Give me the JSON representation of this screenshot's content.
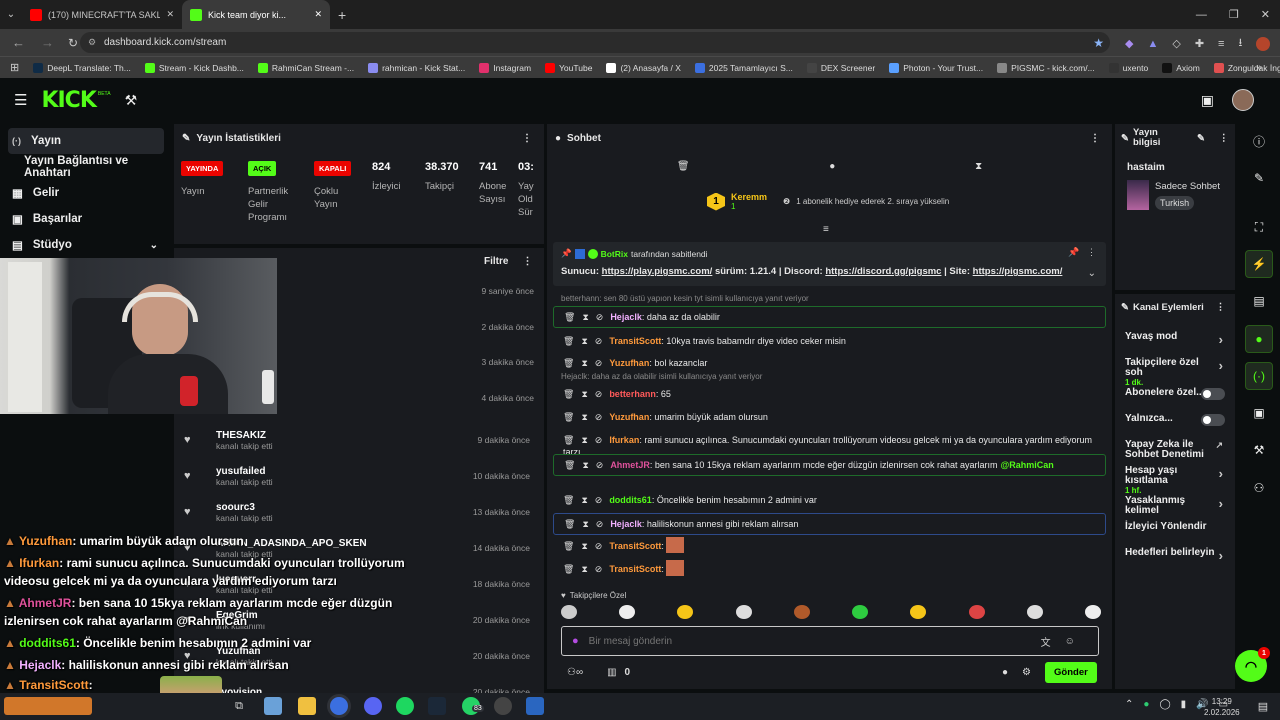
{
  "browser": {
    "tabs": [
      {
        "title": "(170) MINECRAFT'TA SAKLAMB",
        "icon": "youtube-icon"
      },
      {
        "title": "Kick team diyor ki...",
        "icon": "kick-icon"
      }
    ],
    "url": "dashboard.kick.com/stream",
    "bookmarks": [
      "DeepL Translate: Th...",
      "Stream - Kick Dashb...",
      "RahmiCan Stream -...",
      "rahmican - Kick Stat...",
      "Instagram",
      "YouTube",
      "(2) Anasayfa / X",
      "2025 Tamamlayıcı S...",
      "DEX Screener",
      "Photon - Your Trust...",
      "PIGSMC - kick.com/...",
      "uxento",
      "Axiom",
      "Zonguldak İngilizce..."
    ]
  },
  "header": {
    "logo": "KICK",
    "logo_sup": "BETA"
  },
  "nav": {
    "items": [
      {
        "label": "Yayın",
        "icon": "(·)"
      },
      {
        "label": "Yayın Bağlantısı ve Anahtarı",
        "icon": ""
      },
      {
        "label": "Gelir",
        "icon": "▦"
      },
      {
        "label": "Başarılar",
        "icon": "▣"
      },
      {
        "label": "Stüdyo",
        "icon": "▤"
      }
    ]
  },
  "stats": {
    "title": "Yayın İstatistikleri",
    "badges": [
      {
        "text": "YAYINDA",
        "label": "Yayın",
        "color": "#eb0400"
      },
      {
        "text": "AÇIK",
        "label": "Partnerlik Gelir Programı",
        "color": "#53fc18"
      },
      {
        "text": "KAPALI",
        "label": "Çoklu Yayın",
        "color": "#eb0400"
      }
    ],
    "numbers": [
      {
        "value": "824",
        "label": "İzleyici"
      },
      {
        "value": "38.370",
        "label": "Takipçi"
      },
      {
        "value": "741",
        "label": "Abone Sayısı"
      },
      {
        "value": "03:",
        "label": "Yay Old Sür"
      }
    ]
  },
  "activity": {
    "filter": "Filtre",
    "times_top": [
      "9 saniye önce",
      "2 dakika önce",
      "3 dakika önce",
      "4 dakika önce"
    ],
    "rows": [
      {
        "name": "THESAKIZ",
        "sub": "kanalı takip etti",
        "time": "9 dakika önce"
      },
      {
        "name": "yusufailed",
        "sub": "kanalı takip etti",
        "time": "10 dakika önce"
      },
      {
        "name": "soourc3",
        "sub": "kanalı takip etti",
        "time": "13 dakika önce"
      },
      {
        "name": "ARDIN_ADASINDA_APO_SKEN",
        "sub": "kanalı takip etti",
        "time": "14 dakika önce"
      },
      {
        "name": "lucquerr",
        "sub": "kanalı takip etti",
        "time": "18 dakika önce"
      },
      {
        "name": "EgeGrim",
        "sub": "link kullanımı",
        "time": "20 dakika önce"
      },
      {
        "name": "Yuzufhan",
        "sub": "kanalı takip etti",
        "time": "20 dakika önce"
      },
      {
        "name": "evovision",
        "sub": "",
        "time": "20 dakika önce"
      }
    ]
  },
  "chat": {
    "title": "Sohbet",
    "top_gifter": {
      "rank": "1",
      "name": "Keremm",
      "count": "1",
      "note": "1 abonelik hediye ederek 2. sıraya yükselin"
    },
    "pinned": {
      "by": "BotRix",
      "by_suffix": "tarafından sabitlendi",
      "text_pre": "Sunucu:",
      "link1": "https://play.pigsmc.com/",
      "text_mid1": "sürüm: 1.21.4 | Discord:",
      "link2": "https://discord.gg/pigsmc",
      "text_mid2": "| Site:",
      "link3": "https://pigsmc.com/"
    },
    "messages": [
      {
        "reply": "betterhann: sen 80 üstü yapıon kesin tyt isimli kullanıcıya yanıt veriyor",
        "user": "Hejaclk",
        "color": "#f2b0ff",
        "text": "daha az da olabilir",
        "hl": "green"
      },
      {
        "reply": "",
        "user": "TransitScott",
        "color": "#ff9a3c",
        "text": "10kya travis babamdır diye video ceker misin",
        "hl": ""
      },
      {
        "reply": "",
        "user": "Yuzufhan",
        "color": "#ff9a3c",
        "text": "bol kazanclar",
        "hl": ""
      },
      {
        "reply": "Hejaclk: daha az da olabilir isimli kullanıcıya yanıt veriyor",
        "user": "betterhann",
        "color": "#ff5a5a",
        "text": "65",
        "hl": ""
      },
      {
        "reply": "",
        "user": "Yuzufhan",
        "color": "#ff9a3c",
        "text": "umarim büyük adam olursun",
        "hl": ""
      },
      {
        "reply": "",
        "user": "Ifurkan",
        "color": "#ff9a3c",
        "text": "rami sunucu açılınca. Sunucumdaki oyuncuları trollüyorum videosu gelcek mi ya da oyunculara yardım ediyorum tarzı",
        "hl": ""
      },
      {
        "reply": "",
        "user": "AhmetJR",
        "color": "#e0529c",
        "text": "ben sana 10 15kya reklam ayarlarım mcde eğer düzgün izlenirsen cok rahat ayarlarım",
        "mention": "@RahmiCan",
        "hl": "green"
      },
      {
        "reply": "",
        "user": "doddits61",
        "color": "#53fc18",
        "text": "Öncelikle benim hesabımın 2 admini var",
        "hl": ""
      },
      {
        "reply": "",
        "user": "Hejaclk",
        "color": "#f2b0ff",
        "text": "haliliskonun annesi gibi reklam alırsan",
        "hl": "blue"
      },
      {
        "reply": "",
        "user": "TransitScott",
        "color": "#ff9a3c",
        "text": "",
        "hl": ""
      },
      {
        "reply": "",
        "user": "TransitScott",
        "color": "#ff9a3c",
        "text": "",
        "hl": ""
      }
    ],
    "emote_section": "Takipçilere Özel",
    "placeholder": "Bir mesaj gönderin",
    "points": "0",
    "send": "Gönder"
  },
  "info": {
    "title": "Yayın bilgisi",
    "stream_title": "hastaim",
    "category": "Sadece Sohbet",
    "tag": "Turkish"
  },
  "actions": {
    "title": "Kanal Eylemleri",
    "items": [
      {
        "label": "Yavaş mod",
        "sub": "",
        "control": "chevron"
      },
      {
        "label": "Takipçilere özel soh",
        "sub": "1 dk.",
        "control": "chevron"
      },
      {
        "label": "Abonelere özel...",
        "sub": "",
        "control": "toggle"
      },
      {
        "label": "Yalnızca...",
        "sub": "",
        "control": "toggle"
      },
      {
        "label": "Yapay Zeka ile Sohbet Denetimi",
        "sub": "",
        "control": "link"
      },
      {
        "label": "Hesap yaşı kısıtlama",
        "sub": "1 hf.",
        "control": "chevron"
      },
      {
        "label": "Yasaklanmış kelimel",
        "sub": "",
        "control": "chevron"
      },
      {
        "label": "İzleyici Yönlendir",
        "sub": "",
        "control": ""
      },
      {
        "label": "Hedefleri belirleyin",
        "sub": "",
        "control": "chevron"
      }
    ]
  },
  "overlay": {
    "lines": [
      {
        "user": "Yuzufhan",
        "color": "#ff9a3c",
        "text": ": umarim büyük adam olursun"
      },
      {
        "user": "Ifurkan",
        "color": "#ff9a3c",
        "text": ": rami sunucu açılınca. Sunucumdaki oyuncuları trollüyorum"
      },
      {
        "user": "",
        "color": "#fff",
        "text": "videosu gelcek mi ya da oyunculara yardım ediyorum tarzı"
      },
      {
        "user": "AhmetJR",
        "color": "#e0529c",
        "text": ": ben sana 10 15kya reklam ayarlarım mcde eğer düzgün"
      },
      {
        "user": "",
        "color": "#fff",
        "text": "izlenirsen cok rahat ayarlarım @RahmiCan"
      },
      {
        "user": "doddits61",
        "color": "#53fc18",
        "text": ": Öncelikle benim hesabımın 2 admini var"
      },
      {
        "user": "Hejaclk",
        "color": "#f2b0ff",
        "text": ": haliliskonun annesi gibi reklam alırsan"
      },
      {
        "user": "TransitScott",
        "color": "#ff9a3c",
        "text": ":"
      }
    ]
  },
  "taskbar": {
    "time": "13:29",
    "date": "2.02.2026",
    "badge": "83"
  },
  "fab_badge": "1"
}
